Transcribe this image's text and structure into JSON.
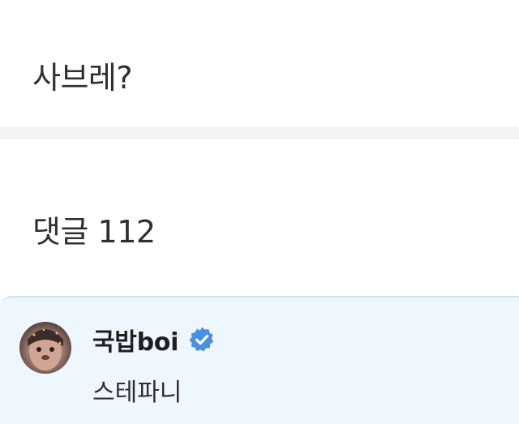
{
  "post": {
    "text": "사브레?"
  },
  "comments": {
    "label": "댓글",
    "count": "112"
  },
  "comment": {
    "author": "국밥boi",
    "verified_icon": "verified-badge-icon",
    "text": "스테파니",
    "accent_color": "#4a90e2",
    "background_color": "#eef7fd"
  }
}
